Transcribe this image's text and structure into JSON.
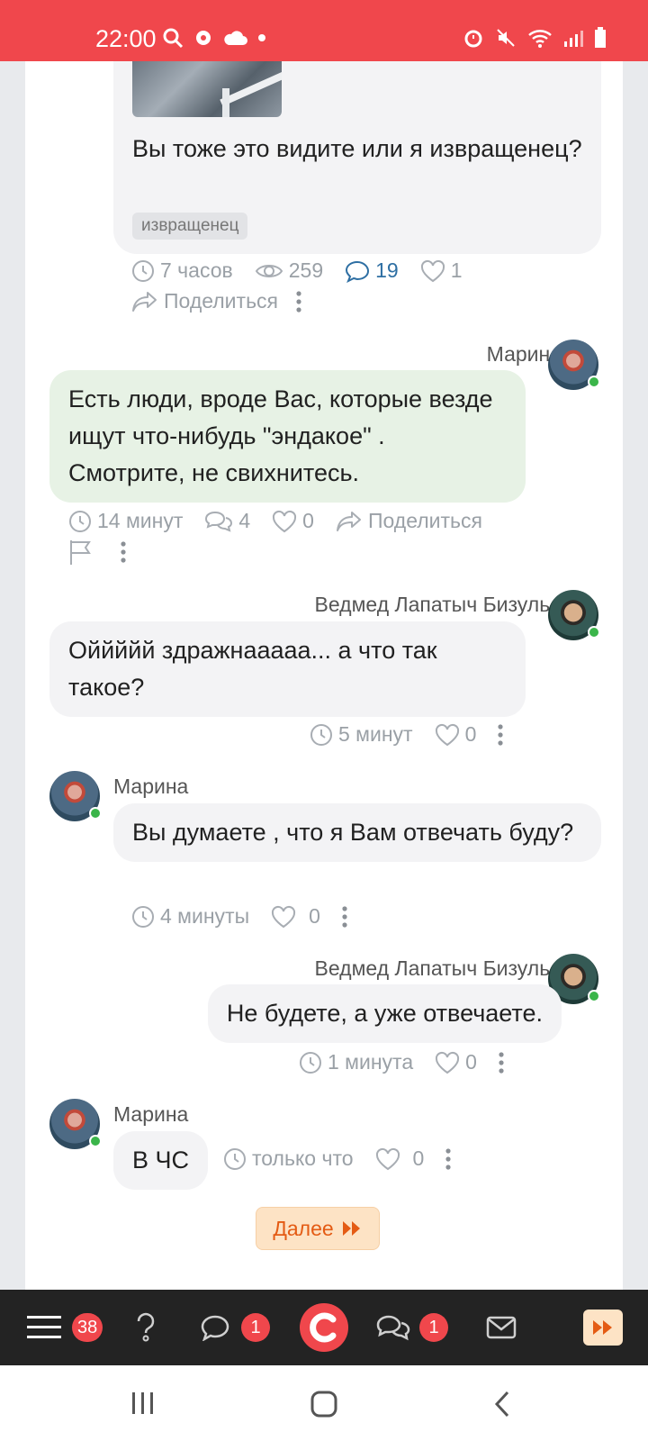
{
  "status_bar": {
    "time": "22:00"
  },
  "post": {
    "text": "Вы тоже это видите или я извращенец?",
    "tag": "извращенец",
    "time": "7 часов",
    "views": "259",
    "comments": "19",
    "likes": "1",
    "share_label": "Поделиться"
  },
  "comments": [
    {
      "author": "Марина",
      "text": "Есть люди, вроде Вас, которые везде ищут что-нибудь \"эндакое\" . Смотрите, не свихнитесь.",
      "time": "14 минут",
      "replies": "4",
      "likes": "0",
      "share_label": "Поделиться"
    },
    {
      "author": "Ведмед Лапатыч Бизульо",
      "text": "Оййййй здражнааааа... а что так такое?",
      "time": "5 минут",
      "likes": "0"
    },
    {
      "author": "Марина",
      "text": "Вы думаете , что я Вам отвечать буду?",
      "time": "4 минуты",
      "likes": "0"
    },
    {
      "author": "Ведмед Лапатыч Бизульо",
      "text": "Не будете, а уже отвечаете.",
      "time": "1 минута",
      "likes": "0"
    },
    {
      "author": "Марина",
      "text": "В ЧС",
      "time": "только что",
      "likes": "0"
    }
  ],
  "next_button": {
    "label": "Далее"
  },
  "bottom_bar": {
    "menu_badge": "38",
    "chat_badge": "1",
    "discussions_badge": "1"
  },
  "colors": {
    "accent": "#f0474c",
    "orange": "#e45b14",
    "green_bubble": "#e7f2e5",
    "link_blue": "#2e6fa3"
  }
}
